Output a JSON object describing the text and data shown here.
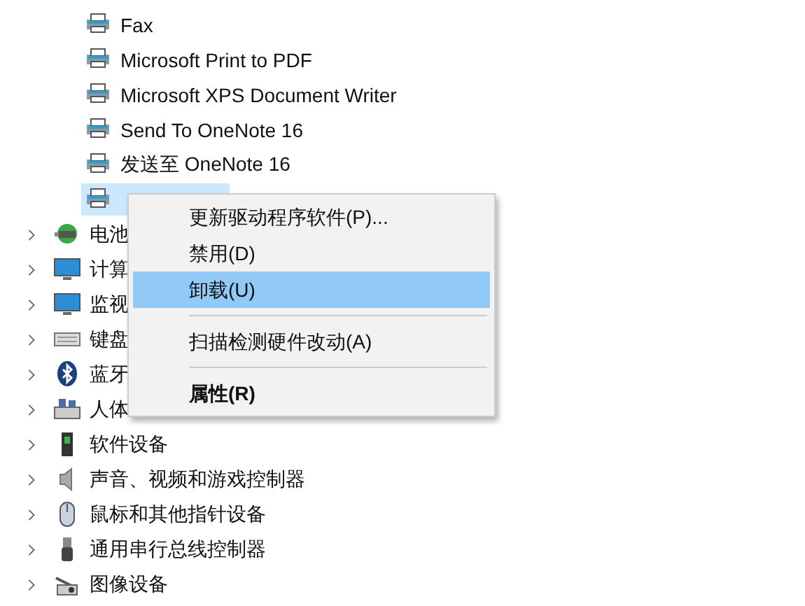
{
  "printers": [
    {
      "label": "Fax",
      "selected": false
    },
    {
      "label": "Microsoft Print to PDF",
      "selected": false
    },
    {
      "label": "Microsoft XPS Document Writer",
      "selected": false
    },
    {
      "label": "Send To OneNote 16",
      "selected": false
    },
    {
      "label": "发送至 OneNote 16",
      "selected": false
    },
    {
      "selected": true
    }
  ],
  "categories": [
    {
      "kind": "battery",
      "label": "电池",
      "expanded": false
    },
    {
      "kind": "computer",
      "label": "计算",
      "expanded": false
    },
    {
      "kind": "monitor",
      "label": "监视",
      "expanded": false
    },
    {
      "kind": "keyboard",
      "label": "键盘",
      "expanded": false
    },
    {
      "kind": "bluetooth",
      "label": "蓝牙",
      "expanded": false
    },
    {
      "kind": "hid",
      "label": "人体",
      "expanded": false
    },
    {
      "kind": "software",
      "label": "软件设备",
      "expanded": false
    },
    {
      "kind": "sound",
      "label": "声音、视频和游戏控制器",
      "expanded": false
    },
    {
      "kind": "mouse",
      "label": "鼠标和其他指针设备",
      "expanded": false
    },
    {
      "kind": "usb",
      "label": "通用串行总线控制器",
      "expanded": false
    },
    {
      "kind": "camera",
      "label": "图像设备",
      "expanded": false
    }
  ],
  "context_menu": [
    {
      "kind": "item",
      "label": "更新驱动程序软件(P)...",
      "selected": false,
      "default": false
    },
    {
      "kind": "item",
      "label": "禁用(D)",
      "selected": false,
      "default": false
    },
    {
      "kind": "item",
      "label": "卸载(U)",
      "selected": true,
      "default": false
    },
    {
      "kind": "separator"
    },
    {
      "kind": "item",
      "label": "扫描检测硬件改动(A)",
      "selected": false,
      "default": false
    },
    {
      "kind": "separator"
    },
    {
      "kind": "item",
      "label": "属性(R)",
      "selected": false,
      "default": true
    }
  ]
}
